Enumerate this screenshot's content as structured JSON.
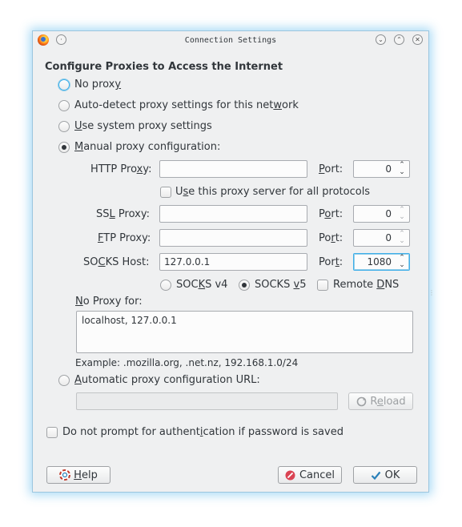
{
  "window": {
    "title": "Connection Settings",
    "controls": {
      "minimize": "⌄",
      "maximize": "⌃",
      "close": "✕"
    }
  },
  "heading": "Configure Proxies to Access the Internet",
  "proxy_modes": [
    {
      "pre": "No prox",
      "key": "y",
      "post": "",
      "selected": false
    },
    {
      "pre": "Auto-detect proxy settings for this net",
      "key": "w",
      "post": "ork",
      "selected": false
    },
    {
      "pre": "",
      "key": "U",
      "post": "se system proxy settings",
      "selected": false
    },
    {
      "pre": "",
      "key": "M",
      "post": "anual proxy configuration:",
      "selected": true
    }
  ],
  "manual": {
    "http": {
      "pre": "HTTP Pro",
      "key": "x",
      "post": "y:",
      "value": "",
      "port_pre": "",
      "port_key": "P",
      "port_post": "ort:",
      "port": "0"
    },
    "share_all": {
      "pre": "U",
      "key": "s",
      "post": "e this proxy server for all protocols",
      "checked": false
    },
    "ssl": {
      "pre": "SS",
      "key": "L",
      "post": " Proxy:",
      "value": "",
      "port_pre": "P",
      "port_key": "o",
      "port_post": "rt:",
      "port": "0"
    },
    "ftp": {
      "pre": "",
      "key": "F",
      "post": "TP Proxy:",
      "value": "",
      "port_pre": "Po",
      "port_key": "r",
      "port_post": "t:",
      "port": "0"
    },
    "socks": {
      "pre": "SO",
      "key": "C",
      "post": "KS Host:",
      "value": "127.0.0.1",
      "port_pre": "Por",
      "port_key": "t",
      "port_post": ":",
      "port": "1080"
    },
    "socks_v4": {
      "pre": "SOC",
      "key": "K",
      "post": "S v4",
      "selected": false
    },
    "socks_v5": {
      "pre": "SOCKS ",
      "key": "v",
      "post": "5",
      "selected": true
    },
    "remote_dns": {
      "pre": "Remote ",
      "key": "D",
      "post": "NS",
      "checked": false
    },
    "no_proxy_label": {
      "pre": "",
      "key": "N",
      "post": "o Proxy for:"
    },
    "no_proxy_value": "localhost, 127.0.0.1",
    "example": "Example: .mozilla.org, .net.nz, 192.168.1.0/24"
  },
  "auto_url": {
    "label": {
      "pre": "",
      "key": "A",
      "post": "utomatic proxy configuration URL:"
    },
    "selected": false,
    "value": "",
    "reload": {
      "pre": "R",
      "key": "e",
      "post": "load"
    }
  },
  "no_auth_prompt": {
    "pre": "Do not prompt for authent",
    "key": "i",
    "post": "cation if password is saved",
    "checked": false
  },
  "buttons": {
    "help": {
      "pre": "",
      "key": "H",
      "post": "elp"
    },
    "cancel": "Cancel",
    "ok": "OK"
  },
  "icons": {
    "app": "firefox-icon",
    "window_menu": "window-menu-icon",
    "help": "help-icon",
    "cancel": "cancel-icon",
    "ok": "checkmark-icon",
    "reload": "reload-icon"
  },
  "colors": {
    "accent": "#3daee9",
    "window_bg": "#eff0f1",
    "text": "#31363b",
    "cancel_red": "#da4453",
    "ok_blue": "#2980b9"
  }
}
